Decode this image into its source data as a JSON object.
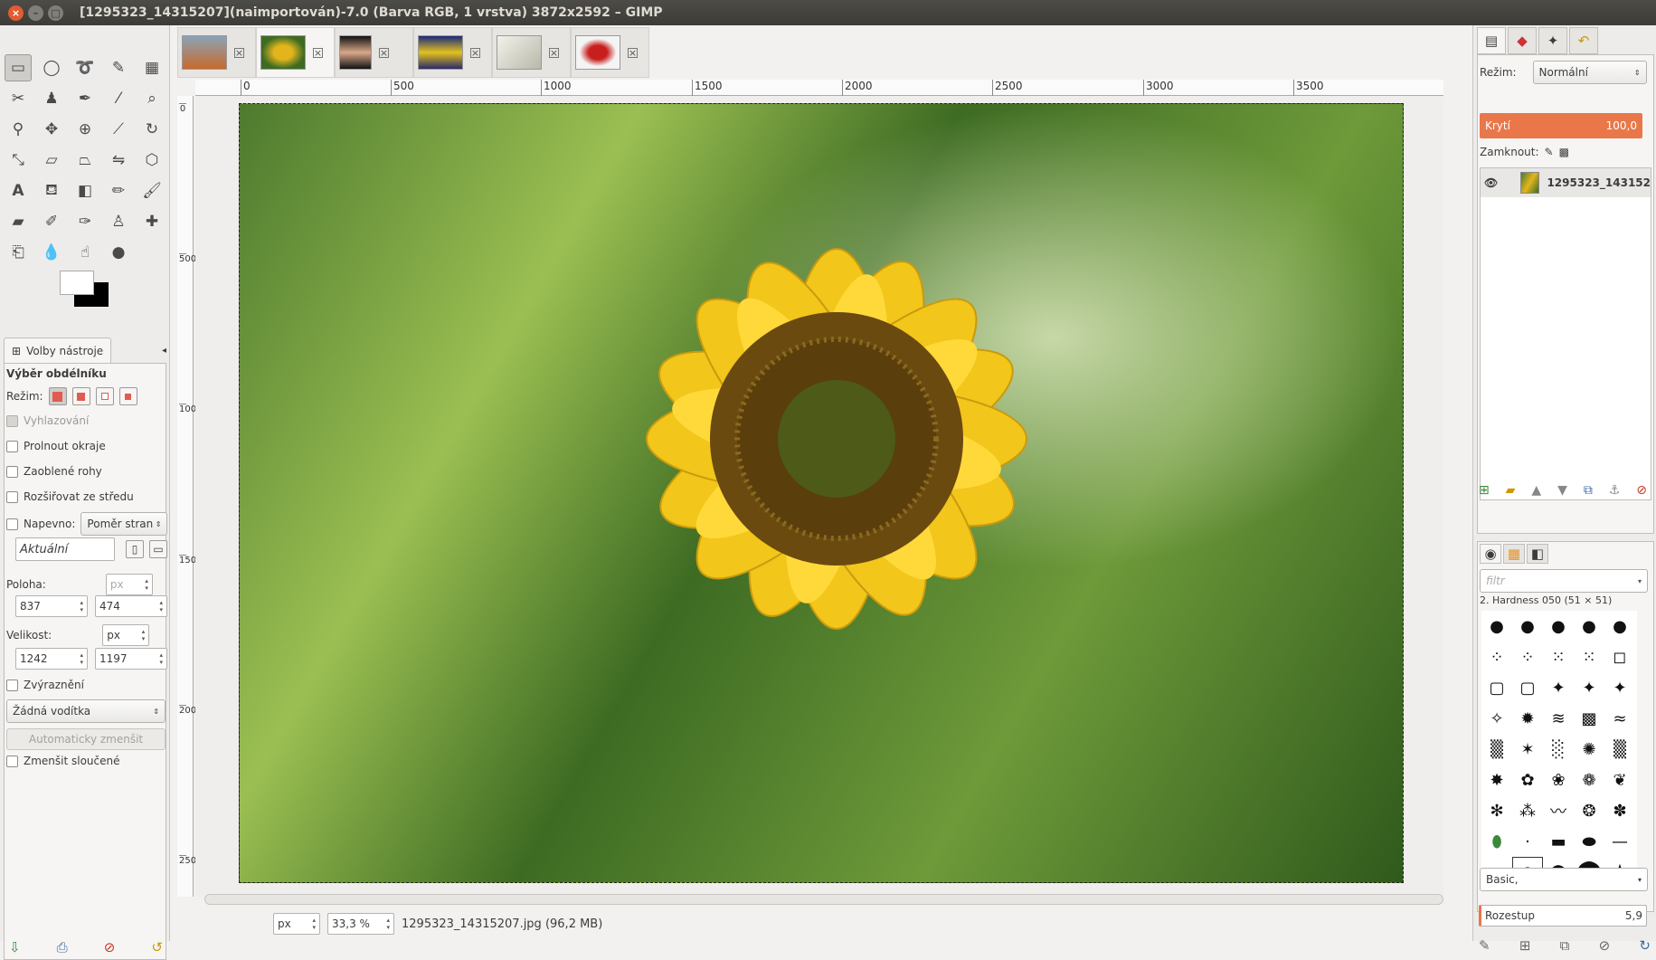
{
  "window": {
    "title": "[1295323_14315207](naimportován)-7.0 (Barva RGB, 1 vrstva) 3872x2592 – GIMP"
  },
  "tool_options": {
    "tab_label": "Volby nástroje",
    "title": "Výběr obdélníku",
    "mode_label": "Režim:",
    "antialias_label": "Vyhlazování",
    "feather_label": "Prolnout okraje",
    "rounded_label": "Zaoblené rohy",
    "expand_label": "Rozšiřovat ze středu",
    "fixed_label": "Napevno:",
    "fixed_option": "Poměr stran",
    "current_value": "Aktuální",
    "position_label": "Poloha:",
    "position_unit": "px",
    "pos_x": "837",
    "pos_y": "474",
    "size_label": "Velikost:",
    "size_unit": "px",
    "size_w": "1242",
    "size_h": "1197",
    "highlight_label": "Zvýraznění",
    "guides_option": "Žádná vodítka",
    "autoshrink_label": "Automaticky zmenšit",
    "shrink_merged_label": "Zmenšit sloučené"
  },
  "rulers": {
    "h": [
      "0",
      "500",
      "1000",
      "1500",
      "2000",
      "2500",
      "3000",
      "3500"
    ],
    "v": [
      "0",
      "500",
      "1000",
      "1500",
      "2000",
      "2500"
    ]
  },
  "status": {
    "unit": "px",
    "zoom": "33,3 %",
    "file_info": "1295323_14315207.jpg (96,2 MB)"
  },
  "layers": {
    "mode_label": "Režim:",
    "mode_value": "Normální",
    "opacity_label": "Krytí",
    "opacity_value": "100,0",
    "lock_label": "Zamknout:",
    "layer_name": "1295323_143152"
  },
  "brushes": {
    "filter_placeholder": "filtr",
    "current_brush": "2. Hardness 050 (51 × 51)",
    "tag_value": "Basic,",
    "spacing_label": "Rozestup",
    "spacing_value": "5,9"
  }
}
